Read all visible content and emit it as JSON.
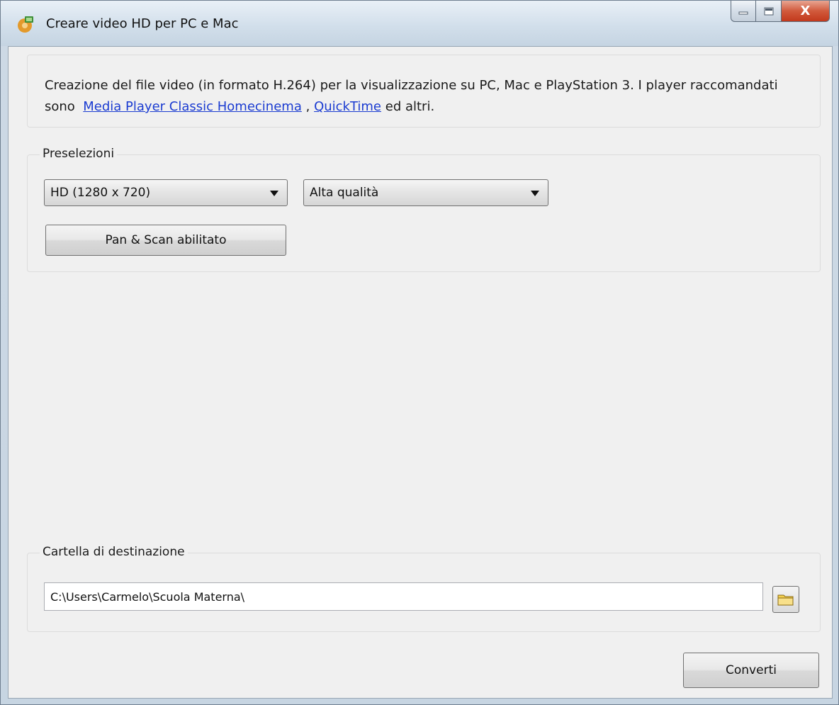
{
  "window": {
    "title": "Creare video HD per PC e Mac",
    "close_glyph": "X"
  },
  "description": {
    "text_before": "Creazione del file video (in formato H.264) per la visualizzazione su PC, Mac e PlayStation 3. I player raccomandati sono",
    "link1": "Media Player Classic Homecinema",
    "separator": ",",
    "link2": "QuickTime",
    "text_after": "ed altri."
  },
  "presets": {
    "group_label": "Preselezioni",
    "resolution_selected": "HD (1280 x 720)",
    "quality_selected": "Alta qualità",
    "pan_scan_label": "Pan & Scan abilitato"
  },
  "destination": {
    "group_label": "Cartella di destinazione",
    "path_value": "C:\\Users\\Carmelo\\Scuola Materna\\"
  },
  "actions": {
    "convert_label": "Converti"
  },
  "icons": {
    "app": "app-icon",
    "minimize": "minimize-icon",
    "maximize": "maximize-icon",
    "close": "close-icon",
    "dropdown": "chevron-down-icon",
    "folder": "folder-icon"
  }
}
